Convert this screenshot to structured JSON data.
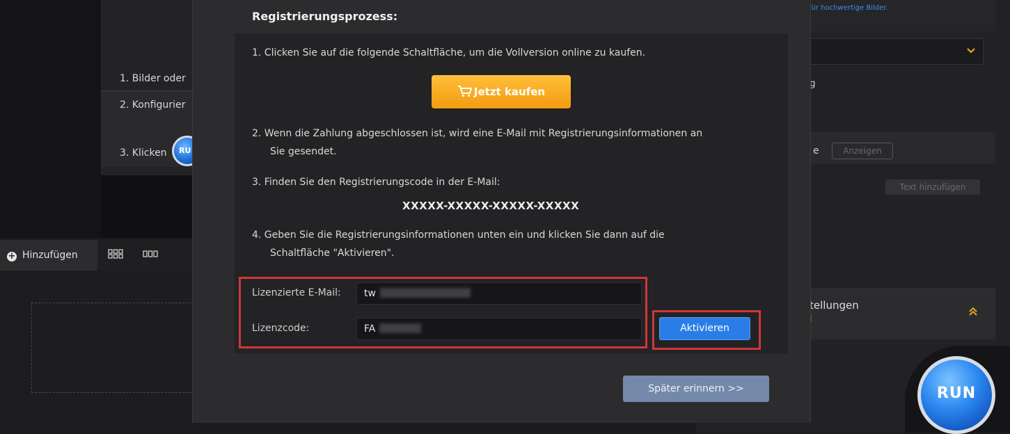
{
  "background_left": {
    "steps": [
      "1. Bilder oder",
      "2. Konfigurier",
      "3. Klicken"
    ],
    "run_small_label": "RU",
    "add_tab_label": "Hinzufügen"
  },
  "background_right": {
    "info_text_line1": "",
    "info_text_line2": "t für hochwertige Bilder.",
    "partial_text_ng": "ng",
    "partial_text_e": "e",
    "show_button": "Anzeigen",
    "add_text_button": "Text hinzufügen",
    "settings_label": "tellungen",
    "settings_sub": "l",
    "run_label": "RUN"
  },
  "dialog": {
    "title": "Registrierungsprozess:",
    "step1": "1.  Clicken Sie auf die folgende Schaltfläche, um die Vollversion online zu kaufen.",
    "buy_button": "Jetzt kaufen",
    "step2_line1": "2.  Wenn die Zahlung abgeschlossen ist, wird eine E-Mail mit Registrierungsinformationen an",
    "step2_line2": "Sie gesendet.",
    "step3": "3.  Finden Sie den Registrierungscode in der E-Mail:",
    "code_sample": "XXXXX-XXXXX-XXXXX-XXXXX",
    "step4_line1": "4.  Geben Sie die Registrierungsinformationen unten ein und klicken Sie dann auf die",
    "step4_line2": "Schaltfläche \"Aktivieren\".",
    "email_label": "Lizenzierte E-Mail:",
    "email_value": "tw",
    "code_label": "Lizenzcode:",
    "code_value": "FA",
    "activate_button": "Aktivieren",
    "later_button": "Später erinnern >>",
    "accent_color": "#2a7de6",
    "highlight_color": "#d0363a"
  }
}
